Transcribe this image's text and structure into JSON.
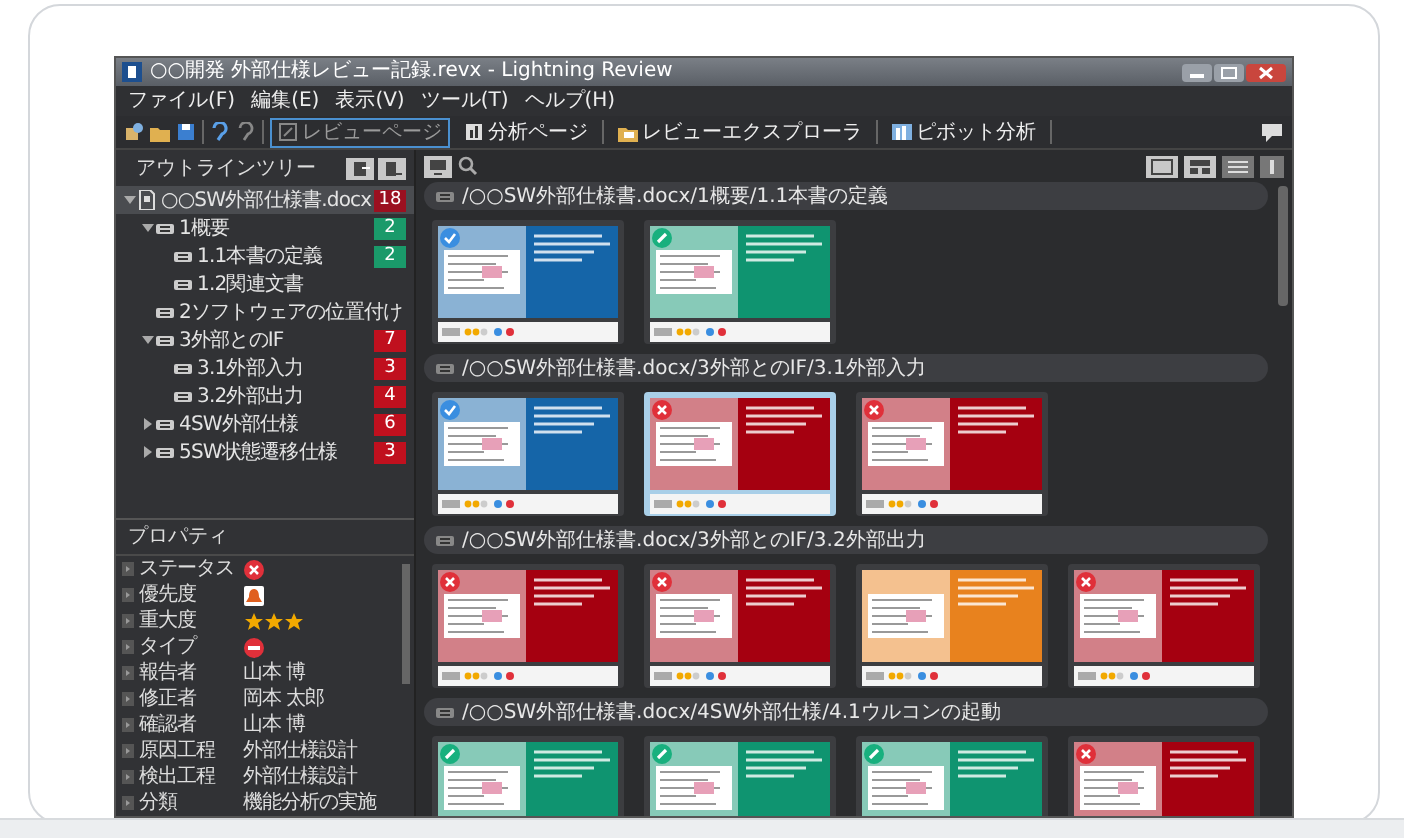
{
  "window": {
    "title": "○○開発 外部仕様レビュー記録.revx - Lightning Review"
  },
  "menu": [
    "ファイル(F)",
    "編集(E)",
    "表示(V)",
    "ツール(T)",
    "ヘルプ(H)"
  ],
  "toolbar": [
    {
      "label": "レビューページ",
      "selected": true
    },
    {
      "label": "分析ページ",
      "selected": false
    },
    {
      "label": "レビューエクスプローラ",
      "selected": false
    },
    {
      "label": "ピボット分析",
      "selected": false
    }
  ],
  "outline": {
    "title": "アウトラインツリー",
    "items": [
      {
        "label": "○○SW外部仕様書.docx",
        "badge": "18",
        "color": "#9b1020",
        "expanded": true,
        "selected": true,
        "children": [
          {
            "label": "1概要",
            "badge": "2",
            "color": "#1a9a6a",
            "expanded": true,
            "selected": false,
            "children": [
              {
                "label": "1.1本書の定義",
                "badge": "2",
                "color": "#1a9a6a",
                "selected": false
              },
              {
                "label": "1.2関連文書",
                "selected": false
              }
            ]
          },
          {
            "label": "2ソフトウェアの位置付け",
            "selected": false
          },
          {
            "label": "3外部とのIF",
            "badge": "7",
            "color": "#c0101e",
            "expanded": true,
            "selected": false,
            "children": [
              {
                "label": "3.1外部入力",
                "badge": "3",
                "color": "#c0101e",
                "selected": false
              },
              {
                "label": "3.2外部出力",
                "badge": "4",
                "color": "#c0101e",
                "selected": false
              }
            ]
          },
          {
            "label": "4SW外部仕様",
            "badge": "6",
            "color": "#c0101e",
            "expanded": false,
            "selected": false
          },
          {
            "label": "5SW状態遷移仕様",
            "badge": "3",
            "color": "#c0101e",
            "expanded": false,
            "selected": false
          }
        ]
      }
    ]
  },
  "properties": {
    "title": "プロパティ",
    "rows": [
      {
        "label": "ステータス",
        "kind": "status"
      },
      {
        "label": "優先度",
        "kind": "priority"
      },
      {
        "label": "重大度",
        "kind": "stars",
        "stars": 3
      },
      {
        "label": "タイプ",
        "kind": "type"
      },
      {
        "label": "報告者",
        "kind": "text",
        "value": "山本 博"
      },
      {
        "label": "修正者",
        "kind": "text",
        "value": "岡本 太郎"
      },
      {
        "label": "確認者",
        "kind": "text",
        "value": "山本 博"
      },
      {
        "label": "原因工程",
        "kind": "text",
        "value": "外部仕様設計"
      },
      {
        "label": "検出工程",
        "kind": "text",
        "value": "外部仕様設計"
      },
      {
        "label": "分類",
        "kind": "text",
        "value": "機能分析の実施"
      }
    ]
  },
  "groups": [
    {
      "path": "/○○SW外部仕様書.docx/1概要/1.1本書の定義",
      "cards": [
        {
          "color": "#1565a8",
          "kind": "check",
          "selected": false
        },
        {
          "color": "#0f9470",
          "kind": "pencil",
          "selected": false
        }
      ]
    },
    {
      "path": "/○○SW外部仕様書.docx/3外部とのIF/3.1外部入力",
      "cards": [
        {
          "color": "#1565a8",
          "kind": "check",
          "selected": false
        },
        {
          "color": "#a50010",
          "kind": "cross",
          "selected": true
        },
        {
          "color": "#a50010",
          "kind": "cross",
          "selected": false
        }
      ]
    },
    {
      "path": "/○○SW外部仕様書.docx/3外部とのIF/3.2外部出力",
      "cards": [
        {
          "color": "#a50010",
          "kind": "cross",
          "selected": false
        },
        {
          "color": "#a50010",
          "kind": "cross",
          "selected": false
        },
        {
          "color": "#e8821e",
          "kind": "plain",
          "selected": false
        },
        {
          "color": "#a50010",
          "kind": "cross",
          "selected": false
        }
      ]
    },
    {
      "path": "/○○SW外部仕様書.docx/4SW外部仕様/4.1ウルコンの起動",
      "cards": [
        {
          "color": "#0f9470",
          "kind": "pencil",
          "selected": false
        },
        {
          "color": "#0f9470",
          "kind": "pencil",
          "selected": false
        },
        {
          "color": "#0f9470",
          "kind": "pencil",
          "selected": false
        },
        {
          "color": "#a50010",
          "kind": "cross",
          "selected": false
        }
      ]
    }
  ]
}
